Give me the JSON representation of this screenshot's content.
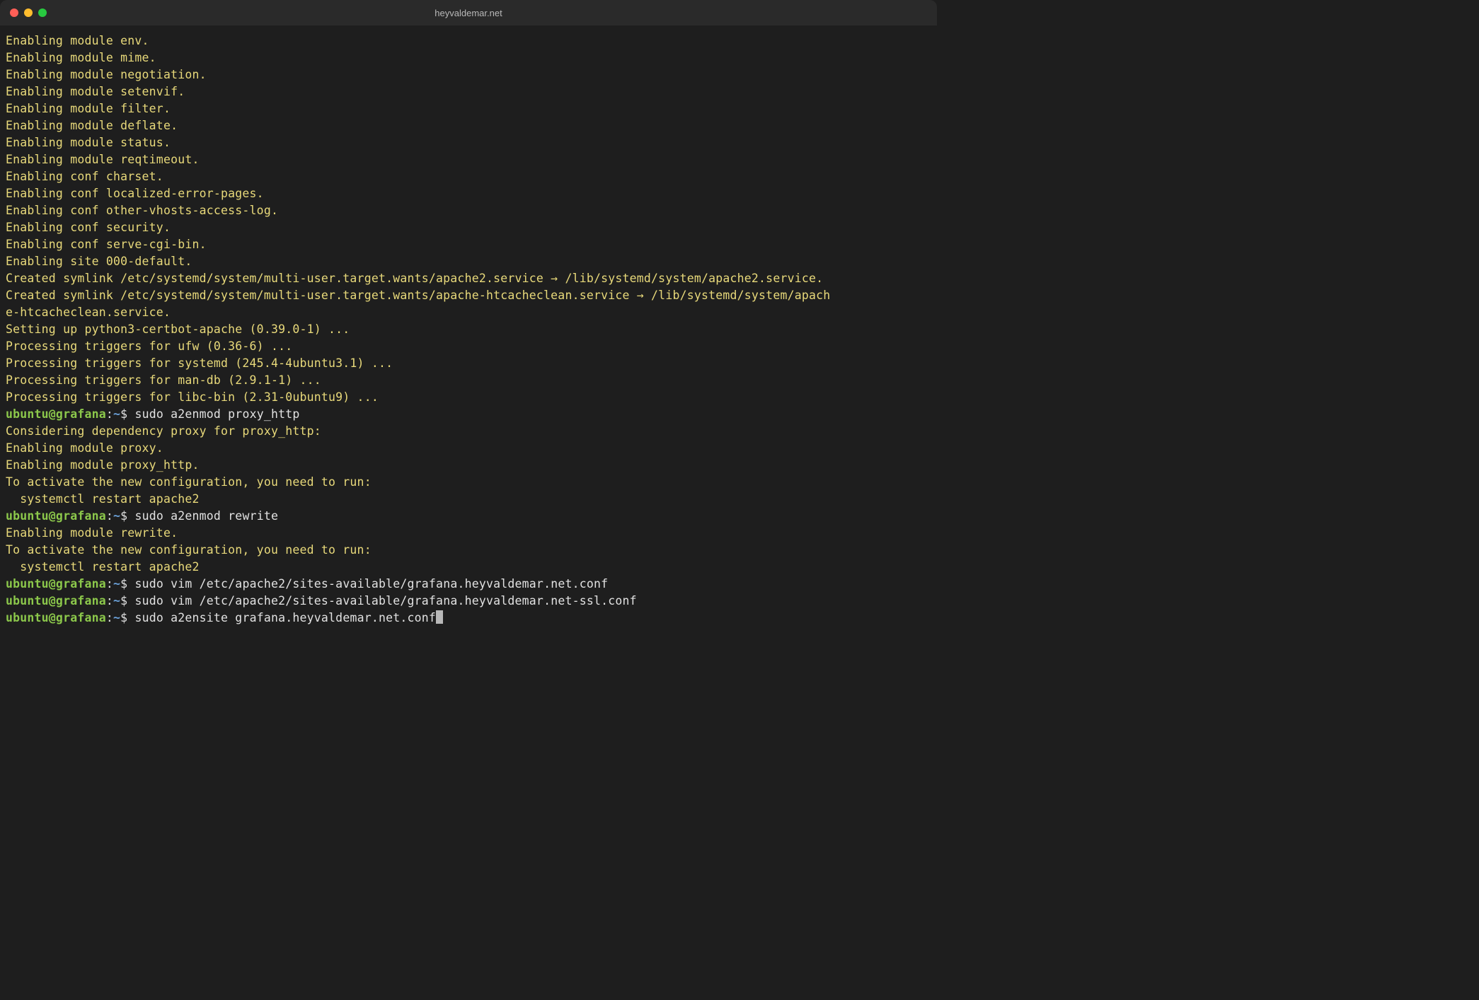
{
  "window": {
    "title": "heyvaldemar.net"
  },
  "colors": {
    "background": "#1e1e1e",
    "titlebar": "#2a2a2a",
    "text_output": "#e8d97a",
    "prompt_user": "#8cc84b",
    "prompt_path": "#6aa0d8",
    "command_text": "#e2e2e2",
    "traffic_close": "#ff5f57",
    "traffic_min": "#ffbd2e",
    "traffic_max": "#28c940"
  },
  "prompt": {
    "user_host": "ubuntu@grafana",
    "separator": ":",
    "path": "~",
    "symbol": "$"
  },
  "output_lines": [
    "Enabling module env.",
    "Enabling module mime.",
    "Enabling module negotiation.",
    "Enabling module setenvif.",
    "Enabling module filter.",
    "Enabling module deflate.",
    "Enabling module status.",
    "Enabling module reqtimeout.",
    "Enabling conf charset.",
    "Enabling conf localized-error-pages.",
    "Enabling conf other-vhosts-access-log.",
    "Enabling conf security.",
    "Enabling conf serve-cgi-bin.",
    "Enabling site 000-default.",
    "Created symlink /etc/systemd/system/multi-user.target.wants/apache2.service → /lib/systemd/system/apache2.service.",
    "Created symlink /etc/systemd/system/multi-user.target.wants/apache-htcacheclean.service → /lib/systemd/system/apach",
    "e-htcacheclean.service.",
    "Setting up python3-certbot-apache (0.39.0-1) ...",
    "Processing triggers for ufw (0.36-6) ...",
    "Processing triggers for systemd (245.4-4ubuntu3.1) ...",
    "Processing triggers for man-db (2.9.1-1) ...",
    "Processing triggers for libc-bin (2.31-0ubuntu9) ..."
  ],
  "sequence": [
    {
      "type": "prompt",
      "command": "sudo a2enmod proxy_http"
    },
    {
      "type": "output",
      "text": "Considering dependency proxy for proxy_http:"
    },
    {
      "type": "output",
      "text": "Enabling module proxy."
    },
    {
      "type": "output",
      "text": "Enabling module proxy_http."
    },
    {
      "type": "output",
      "text": "To activate the new configuration, you need to run:"
    },
    {
      "type": "output",
      "text": "  systemctl restart apache2"
    },
    {
      "type": "prompt",
      "command": "sudo a2enmod rewrite"
    },
    {
      "type": "output",
      "text": "Enabling module rewrite."
    },
    {
      "type": "output",
      "text": "To activate the new configuration, you need to run:"
    },
    {
      "type": "output",
      "text": "  systemctl restart apache2"
    },
    {
      "type": "prompt",
      "command": "sudo vim /etc/apache2/sites-available/grafana.heyvaldemar.net.conf"
    },
    {
      "type": "prompt",
      "command": "sudo vim /etc/apache2/sites-available/grafana.heyvaldemar.net-ssl.conf"
    },
    {
      "type": "prompt",
      "command": "sudo a2ensite grafana.heyvaldemar.net.conf",
      "cursor": true
    }
  ]
}
